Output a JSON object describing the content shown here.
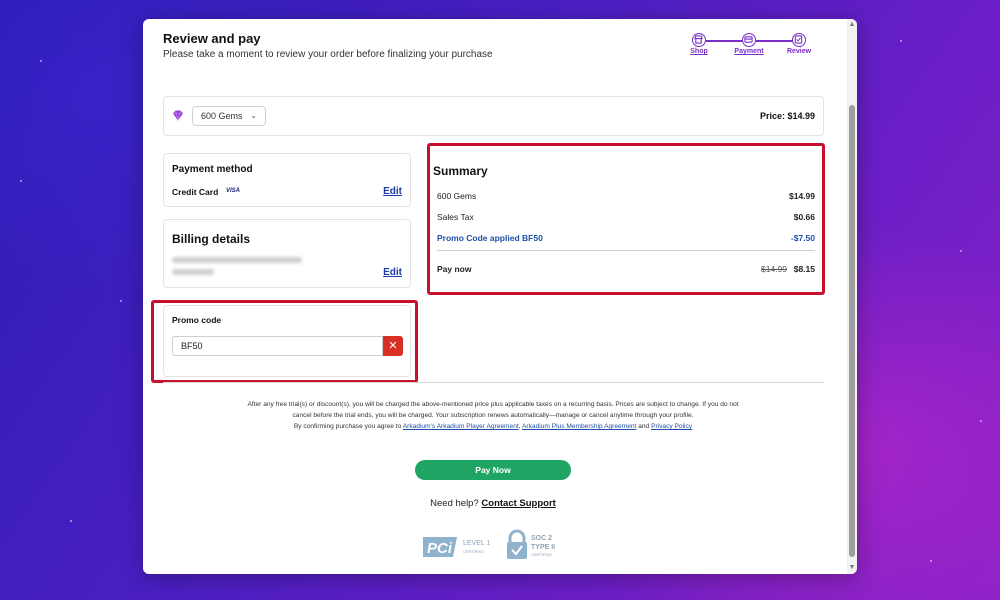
{
  "header": {
    "title": "Review and pay",
    "subtitle": "Please take a moment to review your order before finalizing your purchase"
  },
  "stepper": {
    "steps": [
      {
        "label": "Shop",
        "icon": "shop-icon"
      },
      {
        "label": "Payment",
        "icon": "payment-icon"
      },
      {
        "label": "Review",
        "icon": "review-icon"
      }
    ],
    "active_step": "Review",
    "accent_color": "#7b2fc6"
  },
  "product": {
    "selected": "600 Gems",
    "price_text": "Price: $14.99",
    "gem_color": "#9b3fd6"
  },
  "payment_method": {
    "title": "Payment method",
    "method": "Credit Card",
    "card_brand": "VISA",
    "edit_label": "Edit"
  },
  "billing": {
    "title": "Billing details",
    "edit_label": "Edit"
  },
  "promo": {
    "title": "Promo code",
    "value": "BF50",
    "clear_icon": "close-icon"
  },
  "summary": {
    "title": "Summary",
    "rows": [
      {
        "label": "600 Gems",
        "value": "$14.99"
      },
      {
        "label": "Sales Tax",
        "value": "$0.66"
      },
      {
        "label": "Promo Code applied BF50",
        "value": "-$7.50"
      }
    ],
    "pay_now_label": "Pay now",
    "old_total": "$14.99",
    "new_total": "$8.15"
  },
  "disclaimer": {
    "line1": "After any free trial(s) or discount(s), you will be charged the above-mentioned price plus applicable taxes on a recurring basis. Prices are subject to change. If you do not cancel before the trial ends, you will be charged. Your subscription renews automatically—manage or cancel anytime through your profile.",
    "line2_prefix": "By confirming purchase you agree to",
    "link1": "Arkadium's Arkadium Player Agreement",
    "link2": "Arkadium Plus Membership Agreement",
    "and_text": "and",
    "link3": "Privacy Policy"
  },
  "actions": {
    "pay_button": "Pay Now",
    "help_text": "Need help?",
    "help_link": "Contact Support"
  },
  "badges": {
    "pci_text": "PCi",
    "pci_level": "LEVEL 1",
    "pci_sub": "CERTIFIED",
    "soc_line1": "SOC 2",
    "soc_line2": "TYPE II",
    "soc_sub": "CERTIFIED"
  },
  "colors": {
    "highlight": "#c8102e",
    "pay_button": "#1fa463",
    "link": "#1e3aa8"
  }
}
